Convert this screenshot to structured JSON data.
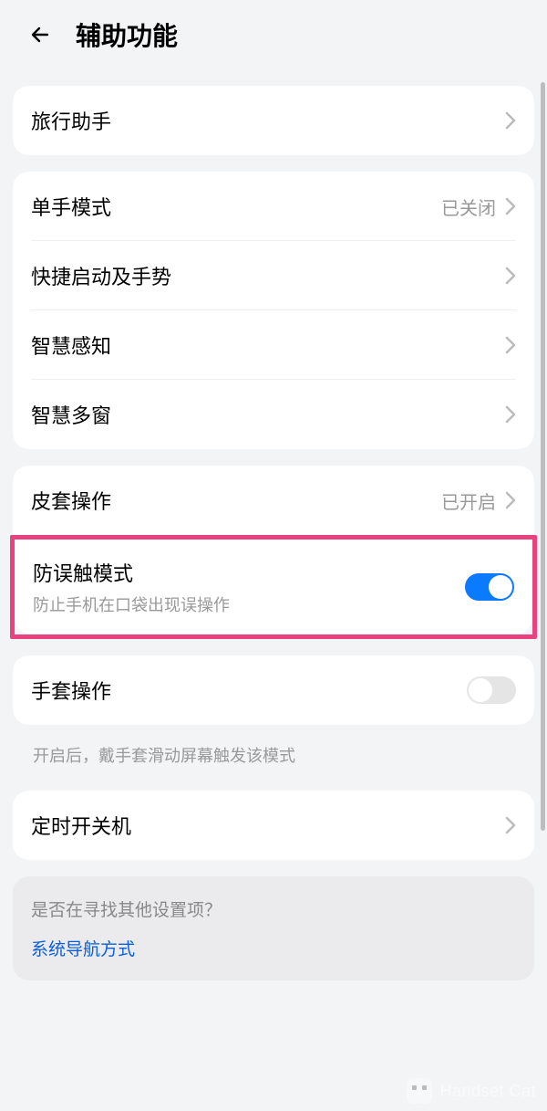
{
  "header": {
    "title": "辅助功能"
  },
  "group1": {
    "travel_assistant": "旅行助手"
  },
  "group2": {
    "one_hand": {
      "label": "单手模式",
      "value": "已关闭"
    },
    "shortcuts": {
      "label": "快捷启动及手势"
    },
    "smart_sense": {
      "label": "智慧感知"
    },
    "smart_window": {
      "label": "智慧多窗"
    }
  },
  "group3": {
    "cover": {
      "label": "皮套操作",
      "value": "已开启"
    },
    "mistouch": {
      "label": "防误触模式",
      "subtitle": "防止手机在口袋出现误操作",
      "on": true
    }
  },
  "group4": {
    "glove": {
      "label": "手套操作",
      "on": false
    },
    "hint": "开启后，戴手套滑动屏幕触发该模式"
  },
  "group5": {
    "schedule": {
      "label": "定时开关机"
    }
  },
  "footer": {
    "question": "是否在寻找其他设置项？",
    "link": "系统导航方式"
  },
  "watermark": "Handset Cat"
}
